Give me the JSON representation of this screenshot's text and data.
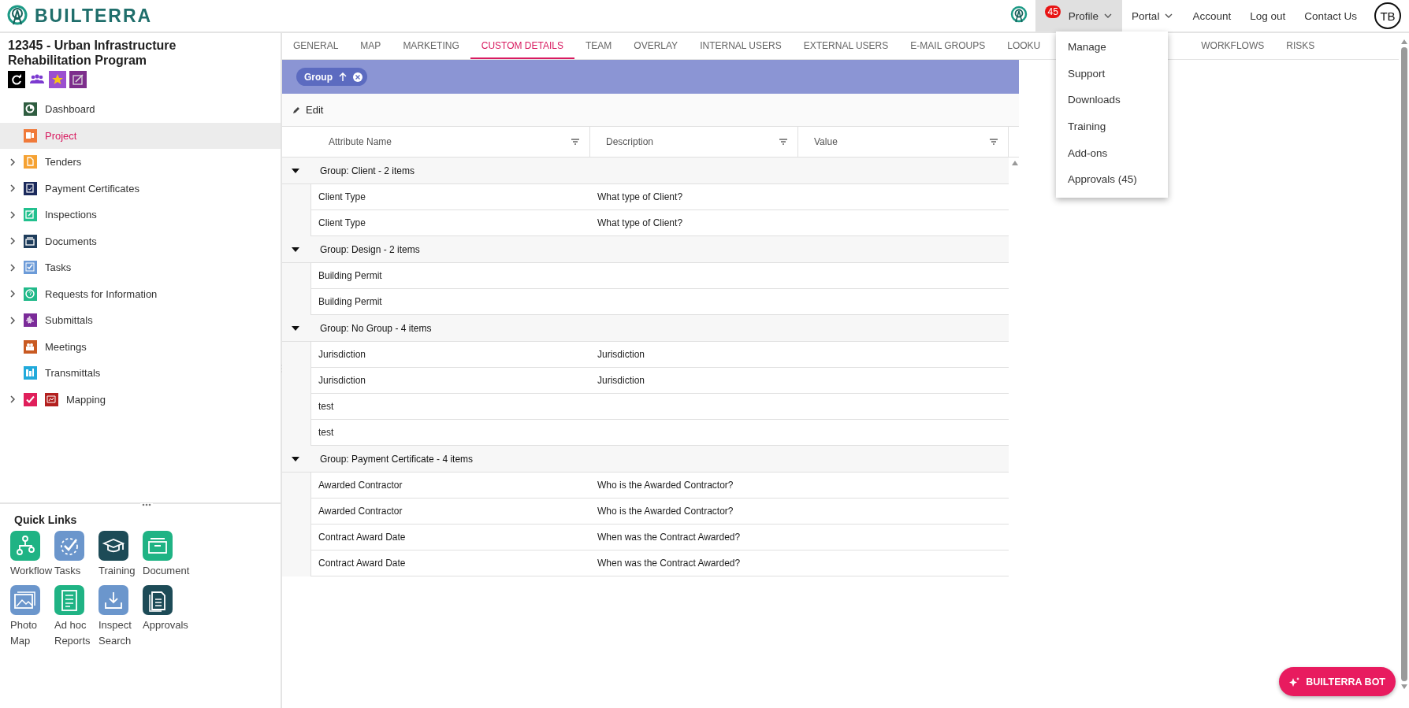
{
  "header": {
    "logo_text": "BUILTERRA",
    "nav": [
      {
        "label": "Profile",
        "badge": "45",
        "dropdown": true,
        "active": true
      },
      {
        "label": "Portal",
        "dropdown": true,
        "active": false
      },
      {
        "label": "Account",
        "dropdown": false,
        "active": false
      },
      {
        "label": "Log out",
        "dropdown": false,
        "active": false
      },
      {
        "label": "Contact Us",
        "dropdown": false,
        "active": false
      }
    ],
    "avatar": "TB"
  },
  "profile_menu": {
    "items": [
      "Manage",
      "Support",
      "Downloads",
      "Training",
      "Add-ons",
      "Approvals (45)"
    ]
  },
  "project": {
    "title": "12345 - Urban Infrastructure Rehabilitation Program"
  },
  "sidebar": {
    "items": [
      {
        "label": "Dashboard",
        "expandable": false,
        "selected": false,
        "color": "#2f5d40"
      },
      {
        "label": "Project",
        "expandable": false,
        "selected": true,
        "color": "#f07a3a"
      },
      {
        "label": "Tenders",
        "expandable": true,
        "selected": false,
        "color": "#f5a233"
      },
      {
        "label": "Payment Certificates",
        "expandable": true,
        "selected": false,
        "color": "#1b2a5c"
      },
      {
        "label": "Inspections",
        "expandable": true,
        "selected": false,
        "color": "#22c08e"
      },
      {
        "label": "Documents",
        "expandable": true,
        "selected": false,
        "color": "#1f3d5c"
      },
      {
        "label": "Tasks",
        "expandable": true,
        "selected": false,
        "color": "#6c9bd8"
      },
      {
        "label": "Requests for Information",
        "expandable": true,
        "selected": false,
        "color": "#22b98a"
      },
      {
        "label": "Submittals",
        "expandable": true,
        "selected": false,
        "color": "#7b2b99"
      },
      {
        "label": "Meetings",
        "expandable": false,
        "selected": false,
        "color": "#c95a22"
      },
      {
        "label": "Transmittals",
        "expandable": false,
        "selected": false,
        "color": "#22aadb"
      },
      {
        "label": "Mapping",
        "expandable": true,
        "selected": false,
        "color": "#b3201f",
        "kind": "layer",
        "checked": true
      }
    ]
  },
  "quick_links": {
    "title": "Quick Links",
    "items": [
      {
        "label": "Workflow",
        "color": "#1fb384"
      },
      {
        "label": "Tasks",
        "color": "#6b96cc"
      },
      {
        "label": "Training",
        "color": "#1d4b57"
      },
      {
        "label": "Document",
        "color": "#1fb384"
      },
      {
        "label": "Photo Map",
        "color": "#6b96cc"
      },
      {
        "label": "Ad hoc Reports",
        "color": "#1fb384"
      },
      {
        "label": "Inspect Search",
        "color": "#6b96cc"
      },
      {
        "label": "Approvals",
        "color": "#1d4b57"
      }
    ]
  },
  "tabs": [
    {
      "label": "GENERAL",
      "selected": false
    },
    {
      "label": "MAP",
      "selected": false
    },
    {
      "label": "MARKETING",
      "selected": false
    },
    {
      "label": "CUSTOM DETAILS",
      "selected": true
    },
    {
      "label": "TEAM",
      "selected": false
    },
    {
      "label": "OVERLAY",
      "selected": false
    },
    {
      "label": "INTERNAL USERS",
      "selected": false
    },
    {
      "label": "EXTERNAL USERS",
      "selected": false
    },
    {
      "label": "E-MAIL GROUPS",
      "selected": false
    },
    {
      "label": "LOOKU",
      "selected": false,
      "kind": "clipped"
    },
    {
      "label": "WORKFLOWS",
      "selected": false
    },
    {
      "label": "RISKS",
      "selected": false
    }
  ],
  "grouping": {
    "chip": "Group"
  },
  "toolbar": {
    "edit": "Edit"
  },
  "table": {
    "columns": [
      "Attribute Name",
      "Description",
      "Value"
    ],
    "groups": [
      {
        "label": "Group: Client - 2 items",
        "expanded": true,
        "rows": [
          {
            "attribute_name": "Client Type",
            "description": "What type of Client?"
          },
          {
            "attribute_name": "Client Type",
            "description": "What type of Client?"
          }
        ]
      },
      {
        "label": "Group: Design - 2 items",
        "expanded": true,
        "rows": [
          {
            "attribute_name": "Building Permit"
          },
          {
            "attribute_name": "Building Permit"
          }
        ]
      },
      {
        "label": "Group: No Group - 4 items",
        "expanded": true,
        "rows": [
          {
            "attribute_name": "Jurisdiction",
            "description": "Jurisdiction"
          },
          {
            "attribute_name": "Jurisdiction",
            "description": "Jurisdiction"
          },
          {
            "attribute_name": "test"
          },
          {
            "attribute_name": "test"
          }
        ]
      },
      {
        "label": "Group: Payment Certificate - 4 items",
        "expanded": true,
        "rows": [
          {
            "attribute_name": "Awarded Contractor",
            "description": "Who is the Awarded Contractor?"
          },
          {
            "attribute_name": "Awarded Contractor",
            "description": "Who is the Awarded Contractor?"
          },
          {
            "attribute_name": "Contract Award Date",
            "description": "When was the Contract Awarded?"
          },
          {
            "attribute_name": "Contract Award Date",
            "description": "When was the Contract Awarded?"
          }
        ]
      }
    ]
  },
  "bot_button": {
    "label": "BUILTERRA BOT"
  }
}
